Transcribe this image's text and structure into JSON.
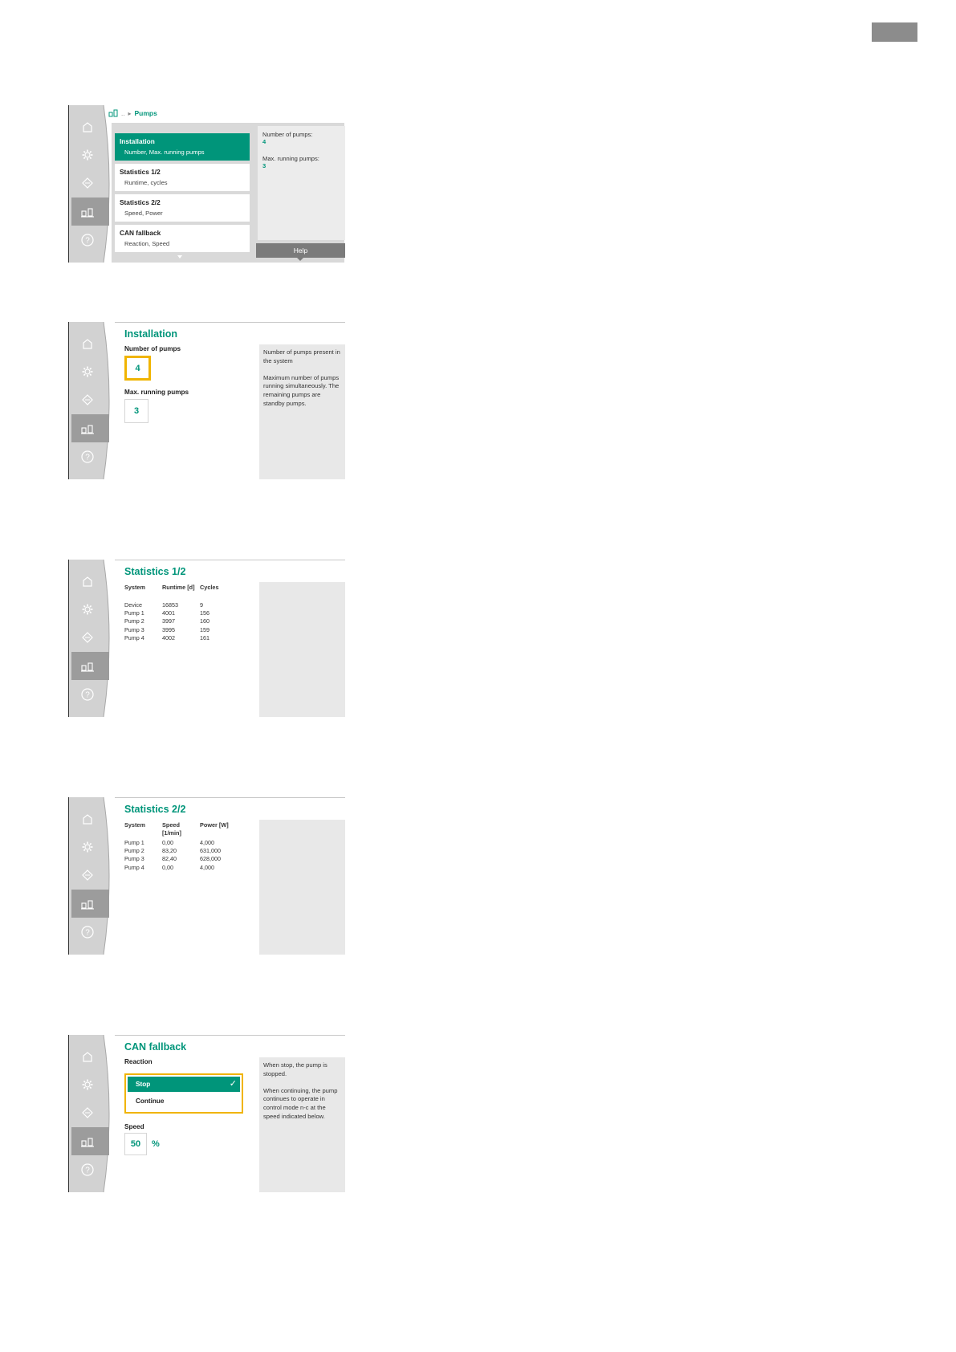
{
  "screen1": {
    "breadcrumb": {
      "ellipsis": "..",
      "current": "Pumps"
    },
    "menu": [
      {
        "title": "Installation",
        "subtitle": "Number, Max. running pumps",
        "selected": true
      },
      {
        "title": "Statistics 1/2",
        "subtitle": "Runtime, cycles",
        "selected": false
      },
      {
        "title": "Statistics 2/2",
        "subtitle": "Speed, Power",
        "selected": false
      },
      {
        "title": "CAN fallback",
        "subtitle": "Reaction, Speed",
        "selected": false
      }
    ],
    "info": [
      {
        "label": "Number of pumps:",
        "value": "4"
      },
      {
        "label": "Max. running pumps:",
        "value": "3"
      }
    ],
    "help_label": "Help"
  },
  "screen2": {
    "title": "Installation",
    "number_label": "Number of pumps",
    "number_value": "4",
    "max_label": "Max. running pumps",
    "max_value": "3",
    "help": [
      "Number of pumps present in the system",
      "Maximum number of pumps running simultaneously. The remaining pumps are standby pumps."
    ]
  },
  "screen3": {
    "title": "Statistics 1/2",
    "headers": [
      "System",
      "Runtime [d]",
      "Cycles"
    ],
    "rows": [
      [
        "Device",
        "16853",
        "9"
      ],
      [
        "Pump 1",
        "4001",
        "156"
      ],
      [
        "Pump 2",
        "3997",
        "160"
      ],
      [
        "Pump 3",
        "3995",
        "159"
      ],
      [
        "Pump 4",
        "4002",
        "161"
      ]
    ]
  },
  "screen4": {
    "title": "Statistics 2/2",
    "headers": [
      "System",
      "Speed [1/min]",
      "Power [W]"
    ],
    "rows": [
      [
        "Pump 1",
        "0,00",
        "4,000"
      ],
      [
        "Pump 2",
        "83,20",
        "631,000"
      ],
      [
        "Pump 3",
        "82,40",
        "628,000"
      ],
      [
        "Pump 4",
        "0,00",
        "4,000"
      ]
    ]
  },
  "screen5": {
    "title": "CAN fallback",
    "reaction_label": "Reaction",
    "options": [
      {
        "label": "Stop",
        "selected": true
      },
      {
        "label": "Continue",
        "selected": false
      }
    ],
    "speed_label": "Speed",
    "speed_value": "50",
    "speed_unit": "%",
    "help": [
      "When stop, the pump is stopped.",
      "When continuing, the pump continues to operate in control mode n-c at the speed indicated below."
    ]
  },
  "colors": {
    "accent": "#00957a",
    "focus": "#f0b400",
    "panel": "#e8e8e8",
    "sidebar": "#d2d2d2"
  }
}
